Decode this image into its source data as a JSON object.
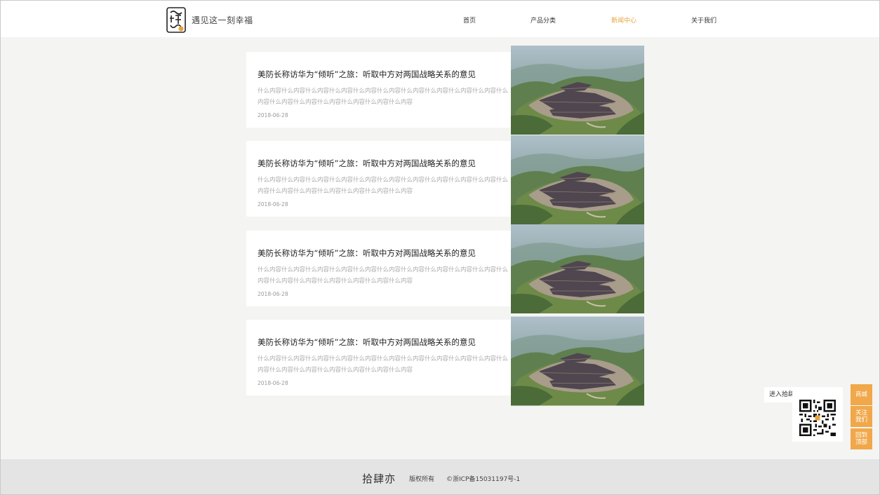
{
  "header": {
    "tagline": "遇见这一刻幸福",
    "nav": [
      {
        "label": "首页"
      },
      {
        "label": "产品分类"
      },
      {
        "label": "新闻中心"
      },
      {
        "label": "关于我们"
      }
    ],
    "active_color": "#e8a23a"
  },
  "news": {
    "items": [
      {
        "title": "美防长称访华为“倾听”之旅：听取中方对两国战略关系的意见",
        "desc": "什么内容什么内容什么内容什么内容什么内容什么内容什么内容什么内容什么内容什么内容什么内容什么内容什么内容什么内容什么内容什么内容什么内容",
        "date": "2018-06-28"
      },
      {
        "title": "美防长称访华为“倾听”之旅：听取中方对两国战略关系的意见",
        "desc": "什么内容什么内容什么内容什么内容什么内容什么内容什么内容什么内容什么内容什么内容什么内容什么内容什么内容什么内容什么内容什么内容什么内容",
        "date": "2018-06-28"
      },
      {
        "title": "美防长称访华为“倾听”之旅：听取中方对两国战略关系的意见",
        "desc": "什么内容什么内容什么内容什么内容什么内容什么内容什么内容什么内容什么内容什么内容什么内容什么内容什么内容什么内容什么内容什么内容什么内容",
        "date": "2018-06-28"
      },
      {
        "title": "美防长称访华为“倾听”之旅：听取中方对两国战略关系的意见",
        "desc": "什么内容什么内容什么内容什么内容什么内容什么内容什么内容什么内容什么内容什么内容什么内容什么内容什么内容什么内容什么内容什么内容什么内容",
        "date": "2018-06-28"
      }
    ]
  },
  "qr": {
    "label": "进入拾肆",
    "icon": "qr-code-icon"
  },
  "side": {
    "shop": "商城",
    "follow": "关注我们",
    "top": "回到顶部",
    "color": "#f0a84a"
  },
  "footer": {
    "brand": "拾肆亦",
    "rights": "版权所有",
    "icp": "©浙ICP备15031197号-1"
  }
}
